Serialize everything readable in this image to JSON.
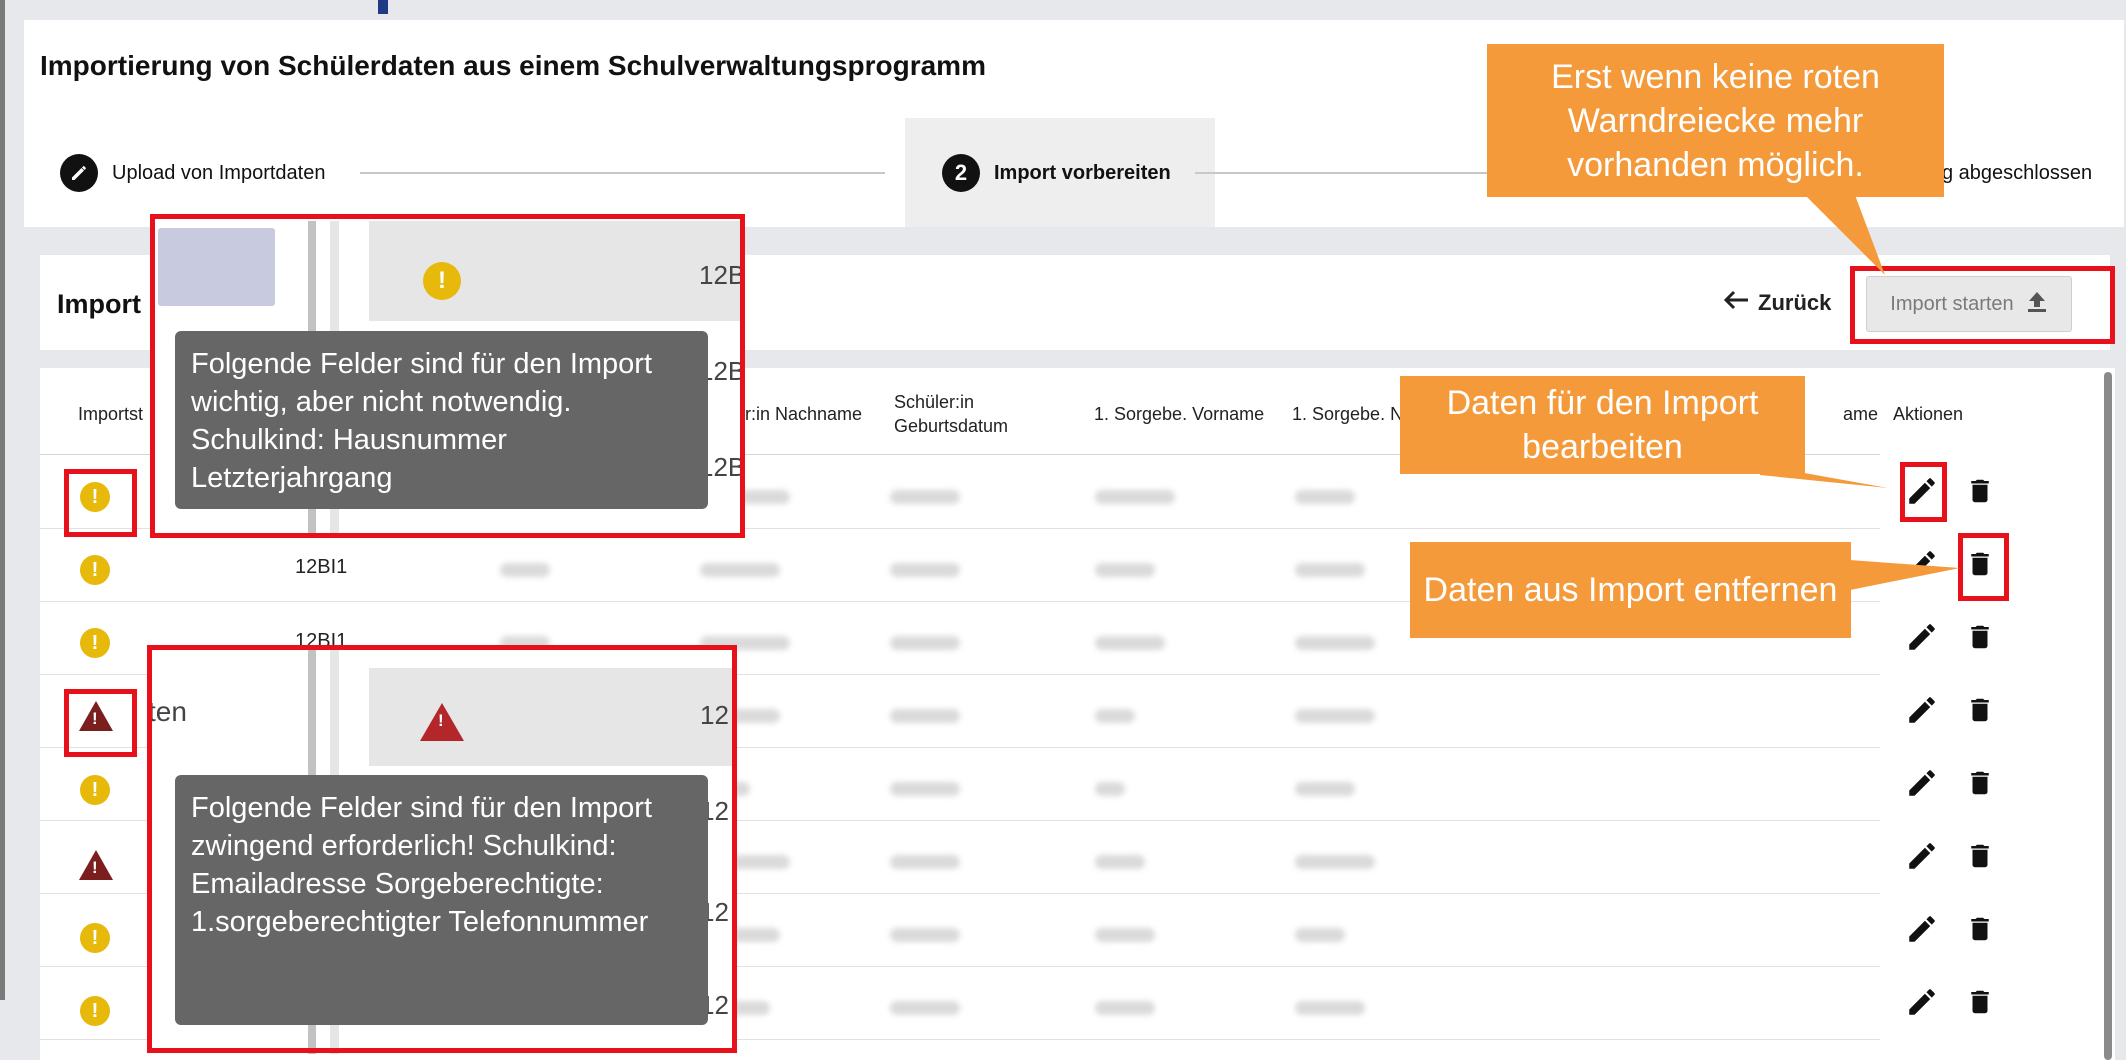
{
  "page_title": "Importierung von Schülerdaten aus einem Schulverwaltungsprogramm",
  "steps": [
    {
      "icon": "pencil-icon",
      "label": "Upload von Importdaten"
    },
    {
      "number": "2",
      "label": "Import vorbereiten"
    },
    {
      "label": "g abgeschlossen"
    }
  ],
  "section_title": "Import",
  "back_label": "Zurück",
  "import_button_label": "Import starten",
  "table": {
    "headers": [
      "Importst",
      "er:in Nachname",
      "Schüler:in Geburtsdatum",
      "1. Sorgebe. Vorname",
      "1. Sorgebe. N",
      "ame",
      "Aktionen"
    ],
    "rows": [
      {
        "status": "yellow",
        "klasse": ""
      },
      {
        "status": "yellow",
        "klasse": "12BI1"
      },
      {
        "status": "yellow",
        "klasse": "12BI1"
      },
      {
        "status": "red",
        "klasse": ""
      },
      {
        "status": "yellow",
        "klasse": ""
      },
      {
        "status": "red",
        "klasse": ""
      },
      {
        "status": "yellow",
        "klasse": ""
      },
      {
        "status": "yellow",
        "klasse": ""
      }
    ]
  },
  "partial_text": {
    "ten": "ten",
    "b1": "12B",
    "b2": "12B",
    "b3": "12B",
    "c1": "12",
    "c2": "12",
    "c3": "12",
    "c4": "12"
  },
  "tooltips": {
    "yellow": "Folgende Felder sind für den Import wichtig, aber nicht notwendig. Schulkind: Hausnummer Letzterjahrgang",
    "red": "Folgende Felder sind für den Import zwingend erforderlich! Schulkind: Emailadresse Sorgeberechtigte: 1.sorgeberechtigter Telefonnummer"
  },
  "callouts": {
    "import_hint": "Erst wenn keine roten Warndreiecke mehr vorhanden möglich.",
    "edit_hint": "Daten für den Import bearbeiten",
    "remove_hint": "Daten aus Import entfernen"
  },
  "colors": {
    "callout": "#f59a3a",
    "highlight": "#e8101a",
    "warn_yellow": "#e7b90b",
    "warn_red": "#7b1e1e",
    "tooltip": "#666666"
  }
}
